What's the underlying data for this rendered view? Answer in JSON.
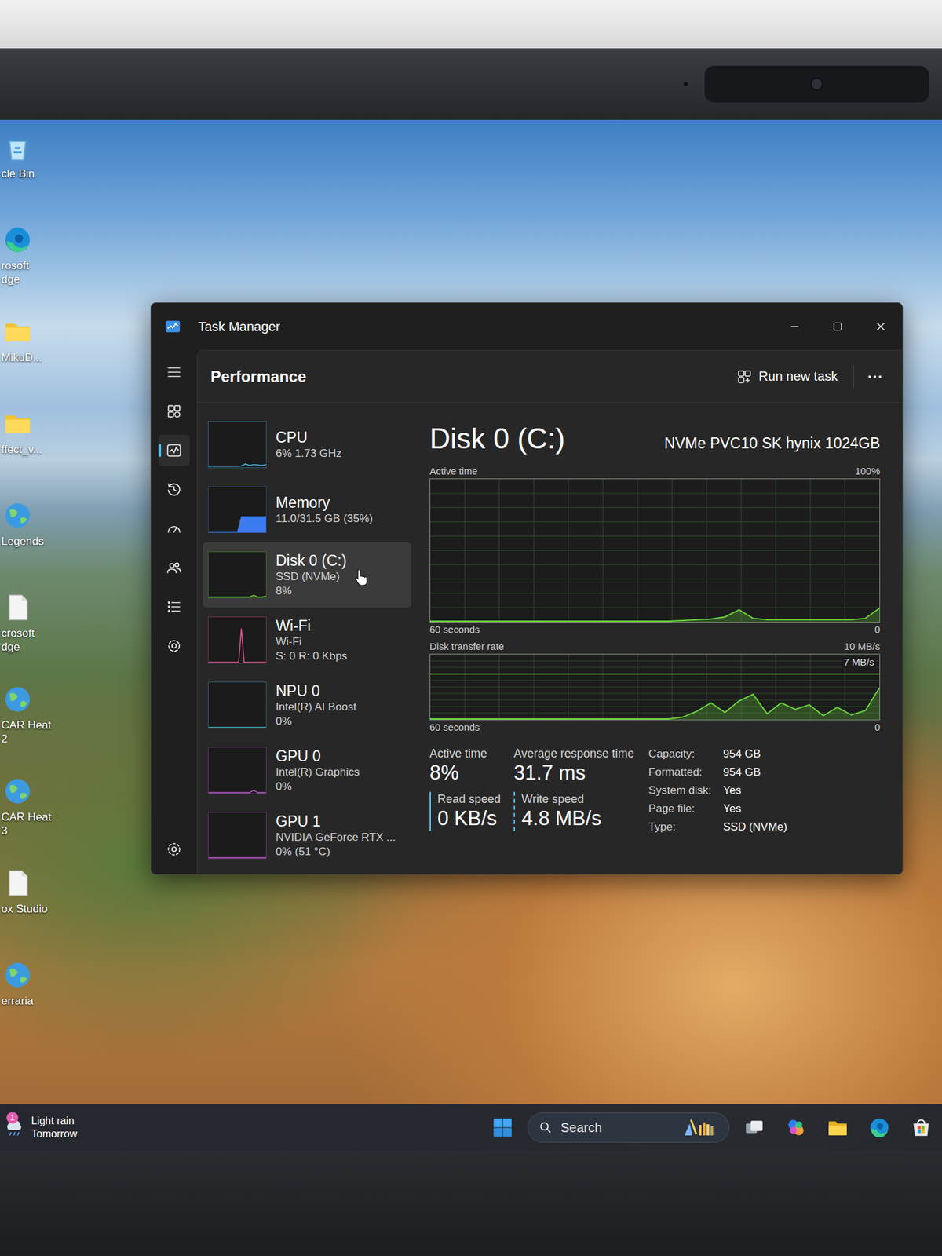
{
  "window": {
    "title": "Task Manager"
  },
  "nav": [
    {
      "kind": "menu",
      "selected": false
    },
    {
      "kind": "processes",
      "selected": false
    },
    {
      "kind": "performance",
      "selected": true
    },
    {
      "kind": "history",
      "selected": false
    },
    {
      "kind": "startup",
      "selected": false
    },
    {
      "kind": "users",
      "selected": false
    },
    {
      "kind": "details",
      "selected": false
    },
    {
      "kind": "services",
      "selected": false
    },
    {
      "kind": "settings",
      "selected": false
    }
  ],
  "header": {
    "title": "Performance",
    "action": "Run new task"
  },
  "resources": [
    {
      "name": "CPU",
      "details": [
        "6% 1.73 GHz"
      ],
      "selected": false,
      "color": "#4cb8e8",
      "kind": "line",
      "spark": [
        1,
        1,
        1,
        1,
        1,
        1,
        1,
        1,
        2,
        6,
        3,
        5,
        4,
        3,
        5
      ]
    },
    {
      "name": "Memory",
      "details": [
        "11.0/31.5 GB (35%)"
      ],
      "selected": false,
      "color": "#3d7bf0",
      "kind": "area",
      "spark": [
        0,
        0,
        0,
        0,
        0,
        0,
        0,
        0,
        35,
        35,
        35,
        35,
        35,
        35,
        35
      ]
    },
    {
      "name": "Disk 0 (C:)",
      "details": [
        "SSD (NVMe)",
        "8%"
      ],
      "selected": true,
      "color": "#6ad13c",
      "kind": "line",
      "spark": [
        0,
        0,
        0,
        0,
        0,
        0,
        0,
        0,
        0,
        0,
        0,
        4,
        0,
        0,
        2
      ]
    },
    {
      "name": "Wi-Fi",
      "details": [
        "Wi-Fi",
        "S: 0 R: 0 Kbps"
      ],
      "selected": false,
      "color": "#e05a9a",
      "kind": "line",
      "spark": [
        0,
        0,
        0,
        0,
        0,
        0,
        0,
        0,
        0,
        0,
        0,
        0,
        75,
        0,
        0,
        0,
        0,
        0,
        0,
        0,
        0,
        0
      ]
    },
    {
      "name": "NPU 0",
      "details": [
        "Intel(R) AI Boost",
        "0%"
      ],
      "selected": false,
      "color": "#3cbccf",
      "kind": "line",
      "spark": [
        0,
        0,
        0,
        0,
        0,
        0,
        0,
        0,
        0,
        0,
        0,
        0,
        0,
        0,
        0
      ]
    },
    {
      "name": "GPU 0",
      "details": [
        "Intel(R) Graphics",
        "0%"
      ],
      "selected": false,
      "color": "#c05ad0",
      "kind": "line",
      "spark": [
        0,
        0,
        0,
        0,
        0,
        0,
        0,
        0,
        0,
        0,
        0,
        5,
        0,
        0,
        0
      ]
    },
    {
      "name": "GPU 1",
      "details": [
        "NVIDIA GeForce RTX ...",
        "0% (51 °C)"
      ],
      "selected": false,
      "color": "#c05ad0",
      "kind": "line",
      "spark": [
        0,
        0,
        0,
        0,
        0,
        0,
        0,
        0,
        0,
        0,
        0,
        0,
        0,
        0,
        0
      ]
    }
  ],
  "detail": {
    "title": "Disk 0 (C:)",
    "model": "NVMe PVC10 SK hynix 1024GB",
    "active_chart": {
      "label": "Active time",
      "max_label": "100%",
      "time_label": "60 seconds",
      "min_label": "0",
      "max": 100,
      "values": [
        0,
        0,
        0,
        0,
        0,
        0,
        0,
        0,
        0,
        0,
        0,
        0,
        0,
        0,
        0,
        0,
        0,
        0,
        0.5,
        1,
        1.5,
        3,
        8,
        2,
        1,
        1,
        1,
        1,
        1,
        1,
        1,
        2,
        9
      ]
    },
    "transfer_chart": {
      "label": "Disk transfer rate",
      "max_label": "10 MB/s",
      "time_label": "60 seconds",
      "min_label": "0",
      "max": 10,
      "reference": 7,
      "reference_label": "7 MB/s",
      "values": [
        0,
        0,
        0,
        0,
        0,
        0,
        0,
        0,
        0,
        0,
        0,
        0,
        0,
        0,
        0,
        0,
        0,
        0,
        0.3,
        1.2,
        2.5,
        1,
        2.8,
        3.8,
        0.8,
        2.5,
        1.5,
        2.2,
        0.5,
        1.8,
        0.6,
        1.3,
        4.8
      ]
    },
    "stats": [
      {
        "label": "Active time",
        "value": "8%"
      },
      {
        "label": "Average response time",
        "value": "31.7 ms"
      }
    ],
    "speeds": [
      {
        "label": "Read speed",
        "value": "0 KB/s",
        "kind": "solid"
      },
      {
        "label": "Write speed",
        "value": "4.8 MB/s",
        "kind": "dashed"
      }
    ],
    "properties": [
      {
        "label": "Capacity:",
        "value": "954 GB"
      },
      {
        "label": "Formatted:",
        "value": "954 GB"
      },
      {
        "label": "System disk:",
        "value": "Yes"
      },
      {
        "label": "Page file:",
        "value": "Yes"
      },
      {
        "label": "Type:",
        "value": "SSD (NVMe)"
      }
    ]
  },
  "desktop_icons": [
    {
      "lines": [
        "cle Bin"
      ],
      "kind": "recycle"
    },
    {
      "lines": [
        "rosoft",
        "dge"
      ],
      "kind": "edge"
    },
    {
      "lines": [
        "MikuD..."
      ],
      "kind": "folder"
    },
    {
      "lines": [
        "ffect_v..."
      ],
      "kind": "folder"
    },
    {
      "lines": [
        "Legends"
      ],
      "kind": "globe"
    },
    {
      "lines": [
        "crosoft",
        "dge"
      ],
      "kind": "file"
    },
    {
      "lines": [
        "CAR Heat",
        "2"
      ],
      "kind": "globe"
    },
    {
      "lines": [
        "CAR Heat",
        "3"
      ],
      "kind": "globe"
    },
    {
      "lines": [
        "ox Studio"
      ],
      "kind": "file"
    },
    {
      "lines": [
        "erraria"
      ],
      "kind": "globe"
    }
  ],
  "taskbar": {
    "weather": {
      "line1": "Light rain",
      "line2": "Tomorrow",
      "badge": "1"
    },
    "search": {
      "placeholder": "Search"
    },
    "pinned": [
      {
        "kind": "taskview"
      },
      {
        "kind": "copilot"
      },
      {
        "kind": "explorer"
      },
      {
        "kind": "edge"
      },
      {
        "kind": "store"
      }
    ]
  }
}
